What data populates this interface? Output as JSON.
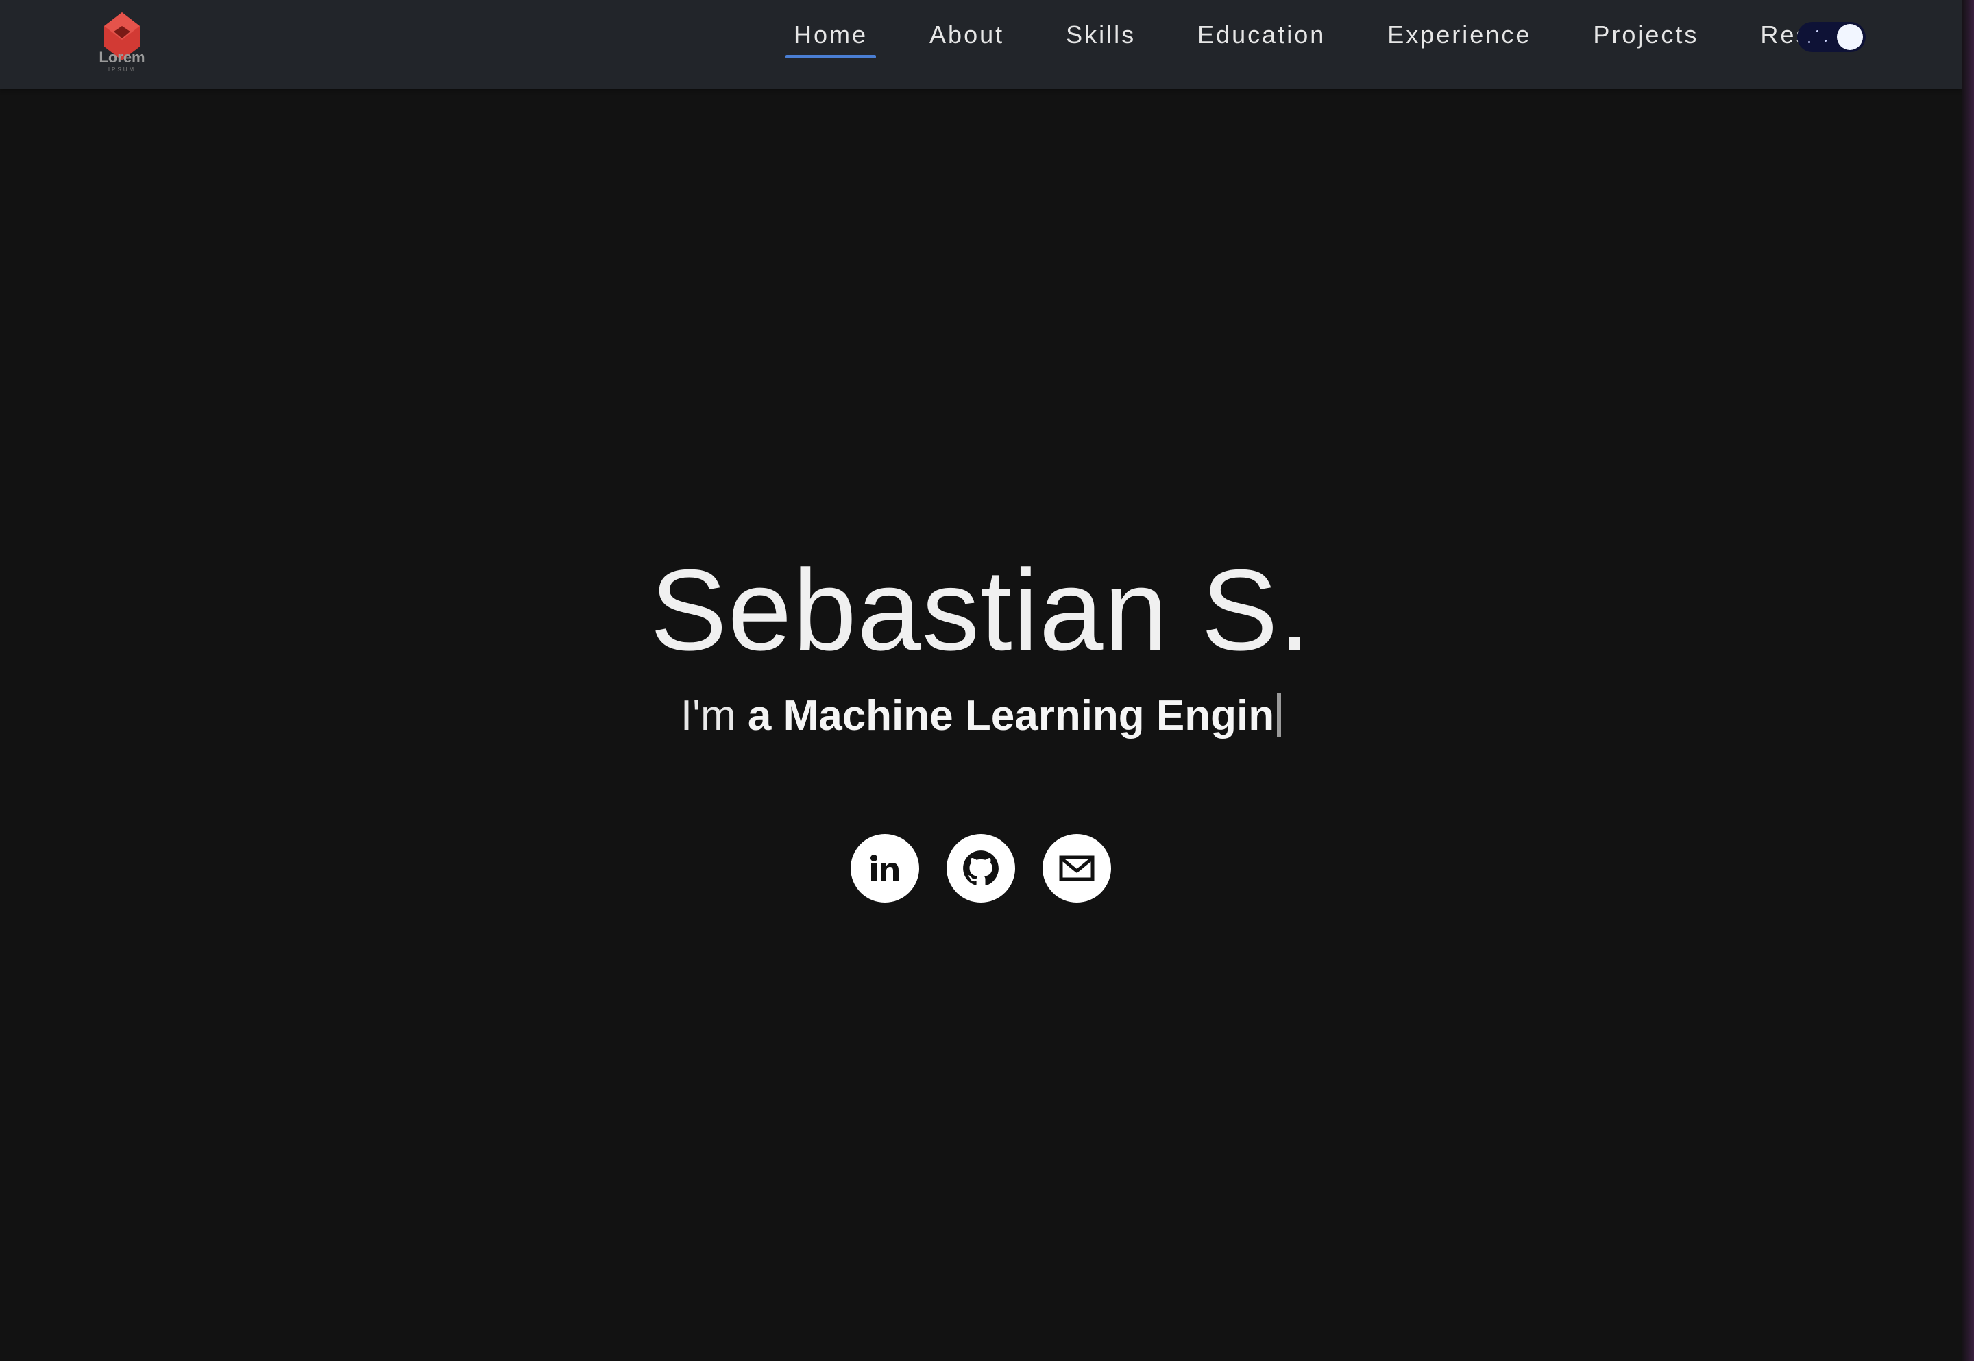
{
  "brand": {
    "logo_text": "Lorem",
    "logo_subtext": "IPSUM",
    "logo_color": "#d23a34"
  },
  "nav": {
    "items": [
      {
        "label": "Home",
        "active": true
      },
      {
        "label": "About",
        "active": false
      },
      {
        "label": "Skills",
        "active": false
      },
      {
        "label": "Education",
        "active": false
      },
      {
        "label": "Experience",
        "active": false
      },
      {
        "label": "Projects",
        "active": false
      },
      {
        "label": "Resume",
        "active": false
      }
    ],
    "active_underline_color": "#4a7ed3",
    "theme_toggle": {
      "state": "dark",
      "icon": "moon-stars-toggle"
    }
  },
  "hero": {
    "name": "Sebastian S.",
    "subtitle_prefix": "I'm",
    "subtitle_role": "a Machine Learning Engin"
  },
  "socials": [
    {
      "icon": "linkedin-icon"
    },
    {
      "icon": "github-icon"
    },
    {
      "icon": "email-icon"
    }
  ],
  "colors": {
    "background": "#121212",
    "navbar": "#22252a",
    "text": "#f0f0f0"
  }
}
